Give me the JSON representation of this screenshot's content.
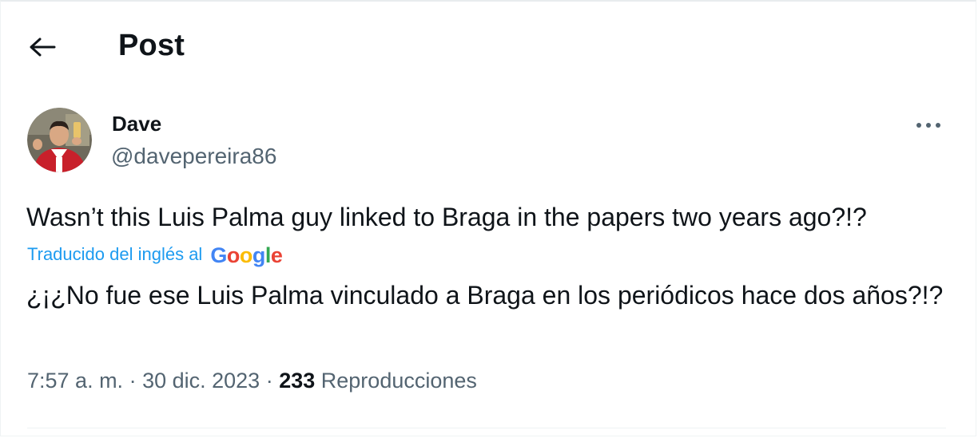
{
  "header": {
    "back_icon": "arrow-left-icon",
    "title": "Post"
  },
  "author": {
    "display_name": "Dave",
    "handle": "@davepereira86",
    "avatar_icon": "user-avatar",
    "more_icon": "more-horizontal-icon"
  },
  "tweet": {
    "text": "Wasn’t this Luis Palma guy linked to Braga in the papers two years ago?!?",
    "translated_label": "Traducido del inglés al",
    "translator_logo": "Google",
    "translation": "¿¡¿No fue ese Luis Palma vinculado a Braga en los periódicos hace dos años?!?"
  },
  "meta": {
    "time": "7:57 a. m.",
    "separator": " · ",
    "date": "30 dic. 2023",
    "views_count": "233",
    "views_label": "Reproducciones"
  },
  "colors": {
    "accent": "#1d9bf0",
    "secondary_text": "#536471",
    "primary_text": "#0f1419"
  }
}
